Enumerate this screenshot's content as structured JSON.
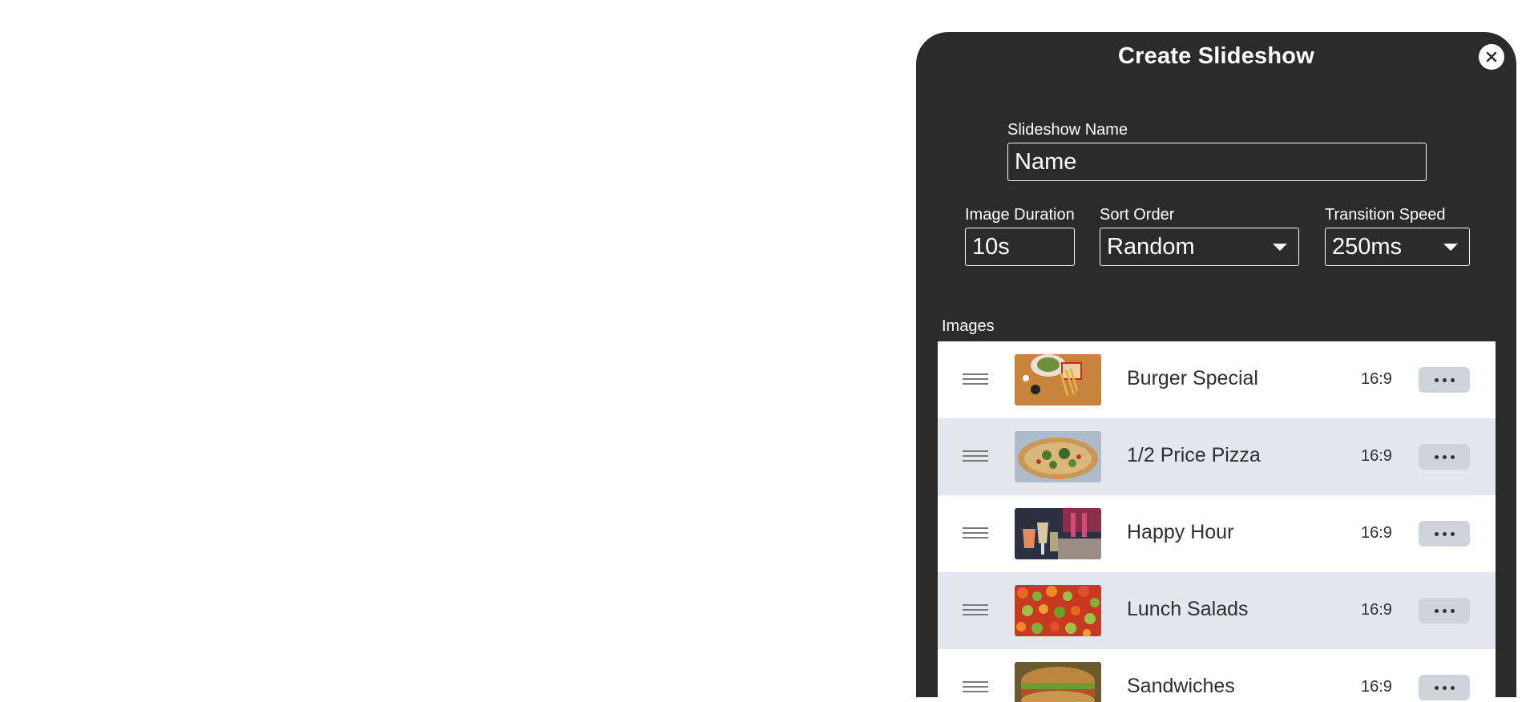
{
  "dialog": {
    "title": "Create Slideshow",
    "close_icon": "close-icon"
  },
  "form": {
    "name_label": "Slideshow Name",
    "name_placeholder": "Name",
    "duration_label": "Image Duration",
    "duration_value": "10s",
    "sort_label": "Sort Order",
    "sort_value": "Random",
    "transition_label": "Transition Speed",
    "transition_value": "250ms"
  },
  "images": {
    "label": "Images",
    "items": [
      {
        "name": "Burger Special",
        "ratio": "16:9",
        "thumb": "burger-thumbnail"
      },
      {
        "name": "1/2 Price Pizza",
        "ratio": "16:9",
        "thumb": "pizza-thumbnail"
      },
      {
        "name": "Happy Hour",
        "ratio": "16:9",
        "thumb": "drinks-thumbnail"
      },
      {
        "name": "Lunch Salads",
        "ratio": "16:9",
        "thumb": "salad-thumbnail"
      },
      {
        "name": "Sandwiches",
        "ratio": "16:9",
        "thumb": "sandwich-thumbnail"
      }
    ]
  }
}
